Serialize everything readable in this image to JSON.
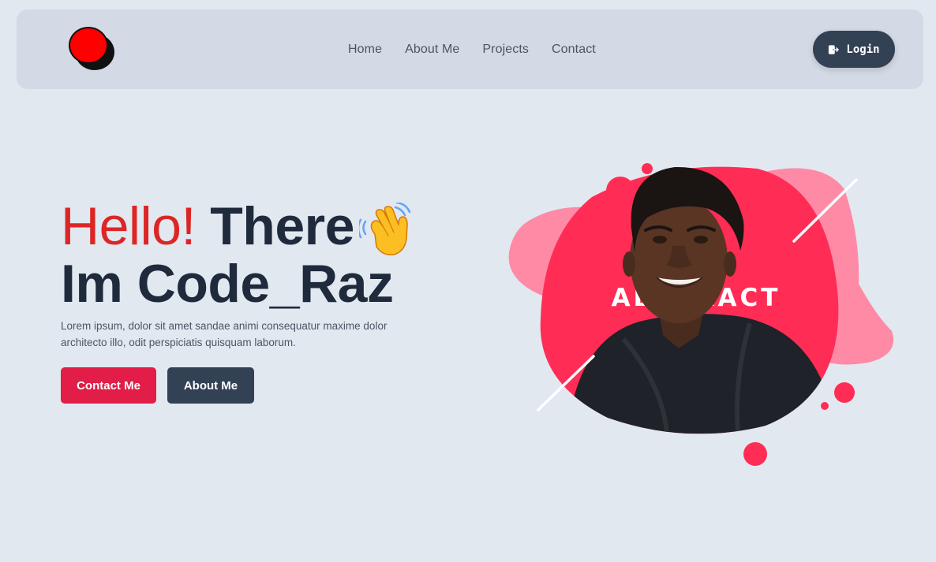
{
  "nav": {
    "links": [
      "Home",
      "About Me",
      "Projects",
      "Contact"
    ],
    "login_label": "Login"
  },
  "hero": {
    "hello": "Hello!",
    "there": "There",
    "name_line": "Im Code_Raz",
    "description": "Lorem ipsum, dolor sit amet sandae animi consequatur maxime dolor architecto illo, odit perspiciatis quisquam laborum.",
    "contact_label": "Contact Me",
    "about_label": "About Me"
  },
  "art": {
    "poster_text": "ABSTRACT"
  },
  "colors": {
    "accent": "#e11d48",
    "dark": "#334155",
    "hello": "#dc2626",
    "blob_light": "#ff8aa6",
    "blob_dark": "#ff2d55"
  },
  "icons": {
    "login": "logout-icon",
    "wave": "waving-hand-icon"
  }
}
